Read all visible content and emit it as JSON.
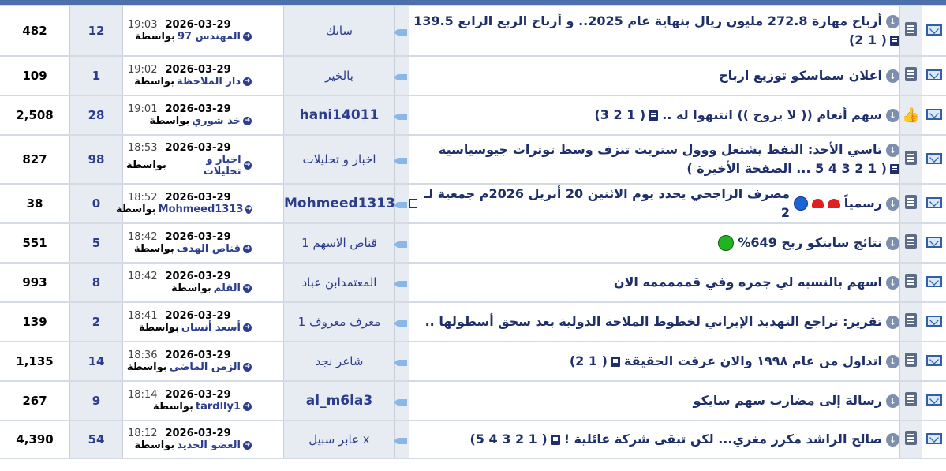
{
  "colors": {
    "accent": "#2b3d8c",
    "row_alt": "#e7ebf2",
    "top_bar": "#4d6fab"
  },
  "threads": [
    {
      "views": "482",
      "replies": "12",
      "time": "19:03",
      "date": "2026-03-29",
      "by_prefix": "بواسطة",
      "last_user": "المهندس 97",
      "author": "سابك",
      "author_bold": false,
      "status_icon": "thread-icon",
      "title_lines": [
        "أرباح مهارة 272.8 مليون ريال بنهاية عام 2025.. و أرباح الربع الرابع 139.5"
      ],
      "pages": "( 1 2)",
      "pages_line": 2
    },
    {
      "views": "109",
      "replies": "1",
      "time": "19:02",
      "date": "2026-03-29",
      "by_prefix": "بواسطة",
      "last_user": "دار الملاحظة",
      "author": "بالخير",
      "author_bold": false,
      "status_icon": "thread-icon",
      "title_lines": [
        "اعلان سماسكو توزيع ارباح"
      ],
      "pages": "",
      "pages_line": 1
    },
    {
      "views": "2,508",
      "replies": "28",
      "time": "19:01",
      "date": "2026-03-29",
      "by_prefix": "بواسطة",
      "last_user": "خذ شوري",
      "author": "hani14011",
      "author_bold": true,
      "status_icon": "thumb-icon",
      "title_lines": [
        "سهم أنعام (( لا يروح )) انتبهوا له .."
      ],
      "pages": "( 1 2 3)",
      "pages_line": 1
    },
    {
      "views": "827",
      "replies": "98",
      "time": "18:53",
      "date": "2026-03-29",
      "by_prefix": "بواسطة",
      "last_user": "اخبار و تحليلات",
      "author": "اخبار و تحليلات",
      "author_bold": false,
      "status_icon": "thread-icon",
      "title_lines": [
        "تاسي الأحد: النفط يشتعل ووول ستريت تنزف وسط توترات جيوسياسية"
      ],
      "pages": "( 1 2 3 4 5 ... الصفحة الأخيرة )",
      "pages_line": 2
    },
    {
      "views": "38",
      "replies": "0",
      "time": "18:52",
      "date": "2026-03-29",
      "by_prefix": "بواسطة",
      "last_user": "Mohmeed1313",
      "author": "Mohmeed1313",
      "author_bold": true,
      "status_icon": "thread-icon",
      "title_lines": [
        "رسمياً",
        "مصرف الراجحي يحدد يوم الاثنين 20 أبريل 2026م جمعية لـ 2"
      ],
      "pages": "",
      "pages_line": 1
    },
    {
      "views": "551",
      "replies": "5",
      "time": "18:42",
      "date": "2026-03-29",
      "by_prefix": "بواسطة",
      "last_user": "قناص الهدف",
      "author": "قناص الاسهم 1",
      "author_bold": false,
      "status_icon": "thread-icon",
      "title_lines": [
        "نتائج سابتكو ربح 649%"
      ],
      "pages": "",
      "pages_line": 1
    },
    {
      "views": "993",
      "replies": "8",
      "time": "18:42",
      "date": "2026-03-29",
      "by_prefix": "بواسطة",
      "last_user": "القلم",
      "author": "المعتمدابن عباد",
      "author_bold": false,
      "status_icon": "thread-icon",
      "title_lines": [
        "اسهم بالنسبه لي جمره وفي قمممممه الان"
      ],
      "pages": "",
      "pages_line": 1
    },
    {
      "views": "139",
      "replies": "2",
      "time": "18:41",
      "date": "2026-03-29",
      "by_prefix": "بواسطة",
      "last_user": "أسعد أنسان",
      "author": "معرف معروف 1",
      "author_bold": false,
      "status_icon": "thread-icon",
      "title_lines": [
        "تقرير: تراجع التهديد الإيراني لخطوط الملاحة الدولية بعد سحق أسطولها .."
      ],
      "pages": "",
      "pages_line": 1
    },
    {
      "views": "1,135",
      "replies": "14",
      "time": "18:36",
      "date": "2026-03-29",
      "by_prefix": "بواسطة",
      "last_user": "الزمن الماضي",
      "author": "شاعر نجد",
      "author_bold": false,
      "status_icon": "thread-icon",
      "title_lines": [
        "اتداول من عام ١٩٩٨ والان عرفت الحقيقة"
      ],
      "pages": "( 1 2)",
      "pages_line": 1
    },
    {
      "views": "267",
      "replies": "9",
      "time": "18:14",
      "date": "2026-03-29",
      "by_prefix": "بواسطة",
      "last_user": "tardlly1",
      "author": "al_m6la3",
      "author_bold": true,
      "status_icon": "thread-icon",
      "title_lines": [
        "رسالة إلى مضارب سهم سايكو"
      ],
      "pages": "",
      "pages_line": 1
    },
    {
      "views": "4,390",
      "replies": "54",
      "time": "18:12",
      "date": "2026-03-29",
      "by_prefix": "بواسطة",
      "last_user": "العضو الجديد",
      "author": "عابر سبيل x",
      "author_bold": false,
      "status_icon": "thread-icon",
      "title_lines": [
        "صالح الراشد مكرر مغري... لكن تبقى شركة عائلية !"
      ],
      "pages": "( 1 2 3 4 5)",
      "pages_line": 1
    }
  ]
}
